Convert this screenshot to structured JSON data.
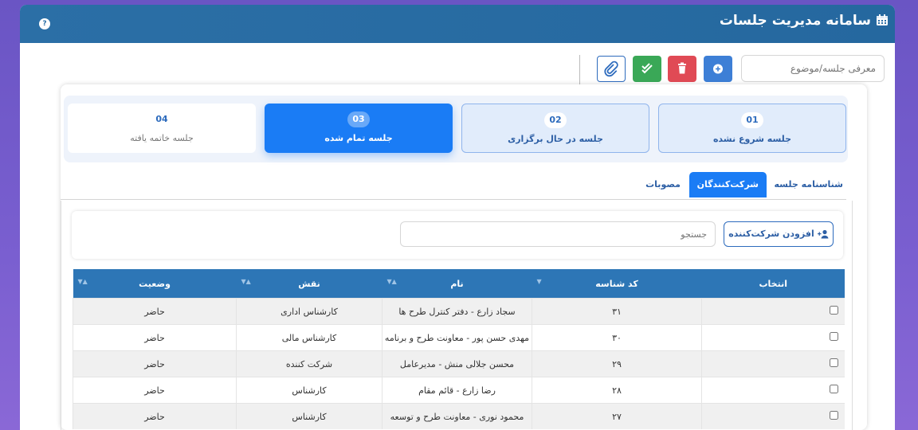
{
  "header": {
    "title": "سامانه مدیریت جلسات",
    "help": "?"
  },
  "toolbar": {
    "topic_placeholder": "معرفی جلسه/موضوع"
  },
  "steps": [
    {
      "num": "01",
      "label": "جلسه شروع نشده"
    },
    {
      "num": "02",
      "label": "جلسه در حال برگزاری"
    },
    {
      "num": "03",
      "label": "جلسه تمام شده"
    },
    {
      "num": "04",
      "label": "جلسه خاتمه یافته"
    }
  ],
  "tabs": [
    {
      "label": "شناسنامه جلسه"
    },
    {
      "label": "شرکت‌کنندگان"
    },
    {
      "label": "مصوبات"
    }
  ],
  "participants": {
    "add_label": "افزودن شرکت‌کننده",
    "search_placeholder": "جستجو"
  },
  "table": {
    "columns": [
      "انتخاب",
      "کد شناسه",
      "نام",
      "نقش",
      "وضعیت"
    ],
    "rows": [
      {
        "code": "۳۱",
        "name": "سجاد زارع - دفتر کنترل طرح ها",
        "role": "کارشناس اداری",
        "status": "حاضر"
      },
      {
        "code": "۳۰",
        "name": "مهدی حسن پور - معاونت طرح و برنامه",
        "role": "کارشناس مالی",
        "status": "حاضر"
      },
      {
        "code": "۲۹",
        "name": "محسن جلالی منش - مدیرعامل",
        "role": "شرکت کننده",
        "status": "حاضر"
      },
      {
        "code": "۲۸",
        "name": "رضا زارع - قائم مقام",
        "role": "کارشناس",
        "status": "حاضر"
      },
      {
        "code": "۲۷",
        "name": "محمود نوری - معاونت طرح و توسعه",
        "role": "کارشناس",
        "status": "حاضر"
      }
    ]
  },
  "colors": {
    "header": "#2b6fa6",
    "accent": "#1a7cf5",
    "danger": "#e04a55",
    "success": "#3aa857"
  }
}
